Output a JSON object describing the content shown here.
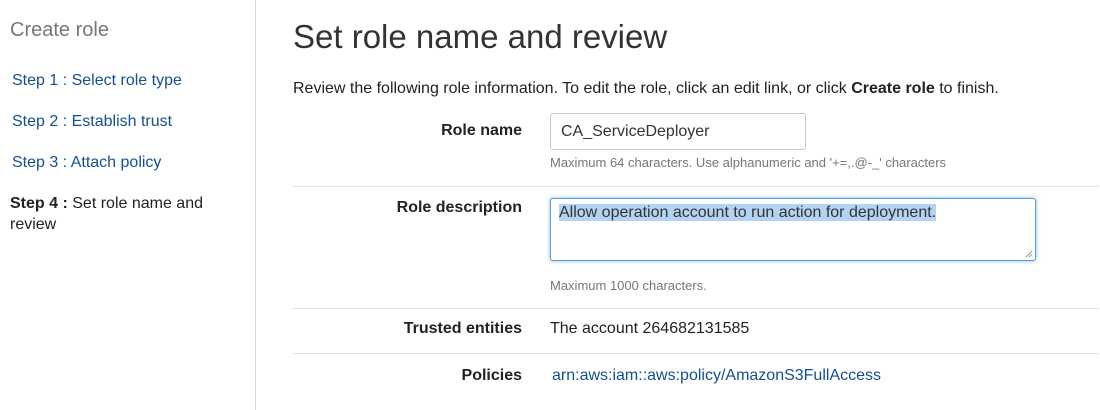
{
  "sidebar": {
    "title": "Create role",
    "steps": [
      {
        "label": "Step 1 : Select role type"
      },
      {
        "label": "Step 2 : Establish trust"
      },
      {
        "label": "Step 3 : Attach policy"
      },
      {
        "prefix": "Step 4 :",
        "label": "Set role name and review"
      }
    ]
  },
  "main": {
    "title": "Set role name and review",
    "intro_before": "Review the following role information. To edit the role, click an edit link, or click ",
    "intro_bold": "Create role",
    "intro_after": " to finish.",
    "role_name": {
      "label": "Role name",
      "value": "CA_ServiceDeployer",
      "hint": "Maximum 64 characters. Use alphanumeric and '+=,.@-_' characters"
    },
    "role_description": {
      "label": "Role description",
      "value": "Allow operation account to run action for deployment.",
      "hint": "Maximum 1000 characters."
    },
    "trusted_entities": {
      "label": "Trusted entities",
      "value": "The account 264682131585"
    },
    "policies": {
      "label": "Policies",
      "link": "arn:aws:iam::aws:policy/AmazonS3FullAccess"
    }
  },
  "colors": {
    "link": "#14508f",
    "selection": "#b4d3f4",
    "focus_border": "#5b9dd9"
  }
}
